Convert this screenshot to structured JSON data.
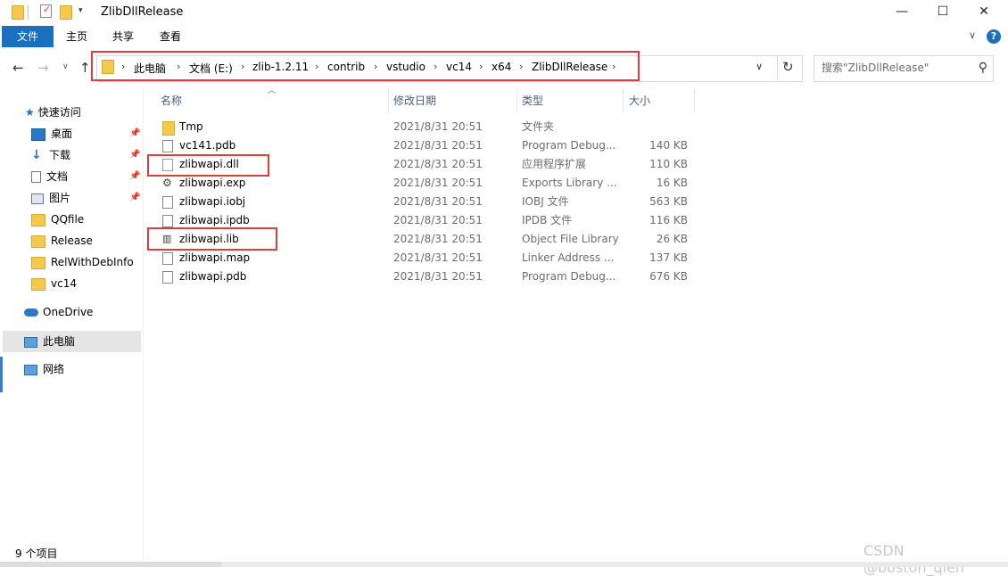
{
  "window": {
    "title": "ZlibDllRelease",
    "controls": {
      "minimize": "—",
      "maximize": "☐",
      "close": "✕"
    }
  },
  "ribbon": {
    "tabs": [
      "文件",
      "主页",
      "共享",
      "查看"
    ],
    "help_label": "?"
  },
  "nav": {
    "breadcrumb": [
      "此电脑",
      "文档 (E:)",
      "zlib-1.2.11",
      "contrib",
      "vstudio",
      "vc14",
      "x64",
      "ZlibDllRelease"
    ],
    "separator": "›",
    "search_placeholder": "搜索\"ZlibDllRelease\""
  },
  "sidebar": {
    "quick_access": "快速访问",
    "items": [
      {
        "label": "桌面",
        "icon": "desktop-icon",
        "pinned": true
      },
      {
        "label": "下载",
        "icon": "download-icon",
        "pinned": true
      },
      {
        "label": "文档",
        "icon": "documents-icon",
        "pinned": true
      },
      {
        "label": "图片",
        "icon": "pictures-icon",
        "pinned": true
      },
      {
        "label": "QQfile",
        "icon": "folder-icon",
        "pinned": false
      },
      {
        "label": "Release",
        "icon": "folder-icon",
        "pinned": false
      },
      {
        "label": "RelWithDebInfo",
        "icon": "folder-icon",
        "pinned": false
      },
      {
        "label": "vc14",
        "icon": "folder-icon",
        "pinned": false
      }
    ],
    "onedrive": "OneDrive",
    "this_pc": "此电脑",
    "network": "网络"
  },
  "columns": {
    "name": "名称",
    "date": "修改日期",
    "type": "类型",
    "size": "大小"
  },
  "files": [
    {
      "name": "Tmp",
      "date": "2021/8/31 20:51",
      "type": "文件夹",
      "size": "",
      "icon": "folder-icon"
    },
    {
      "name": "vc141.pdb",
      "date": "2021/8/31 20:51",
      "type": "Program Debug...",
      "size": "140 KB",
      "icon": "pdb-file-icon"
    },
    {
      "name": "zlibwapi.dll",
      "date": "2021/8/31 20:51",
      "type": "应用程序扩展",
      "size": "110 KB",
      "icon": "dll-file-icon"
    },
    {
      "name": "zlibwapi.exp",
      "date": "2021/8/31 20:51",
      "type": "Exports Library ...",
      "size": "16 KB",
      "icon": "exp-file-icon"
    },
    {
      "name": "zlibwapi.iobj",
      "date": "2021/8/31 20:51",
      "type": "IOBJ 文件",
      "size": "563 KB",
      "icon": "file-icon"
    },
    {
      "name": "zlibwapi.ipdb",
      "date": "2021/8/31 20:51",
      "type": "IPDB 文件",
      "size": "116 KB",
      "icon": "file-icon"
    },
    {
      "name": "zlibwapi.lib",
      "date": "2021/8/31 20:51",
      "type": "Object File Library",
      "size": "26 KB",
      "icon": "lib-file-icon"
    },
    {
      "name": "zlibwapi.map",
      "date": "2021/8/31 20:51",
      "type": "Linker Address ...",
      "size": "137 KB",
      "icon": "map-file-icon"
    },
    {
      "name": "zlibwapi.pdb",
      "date": "2021/8/31 20:51",
      "type": "Program Debug...",
      "size": "676 KB",
      "icon": "pdb-file-icon"
    }
  ],
  "status": {
    "item_count": "9 个项目"
  },
  "watermark": "CSDN @boston_qien",
  "colors": {
    "accent": "#1a6fbe",
    "highlight": "#e03c3c",
    "folder": "#f5c94b"
  }
}
